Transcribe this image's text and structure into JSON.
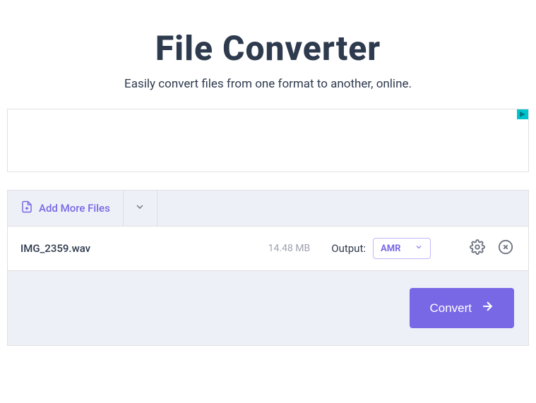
{
  "header": {
    "title": "File Converter",
    "subtitle": "Easily convert files from one format to another, online."
  },
  "toolbar": {
    "add_files_label": "Add More Files"
  },
  "file": {
    "name": "IMG_2359.wav",
    "size": "14.48 MB",
    "output_label": "Output:",
    "format": "AMR"
  },
  "footer": {
    "convert_label": "Convert"
  }
}
